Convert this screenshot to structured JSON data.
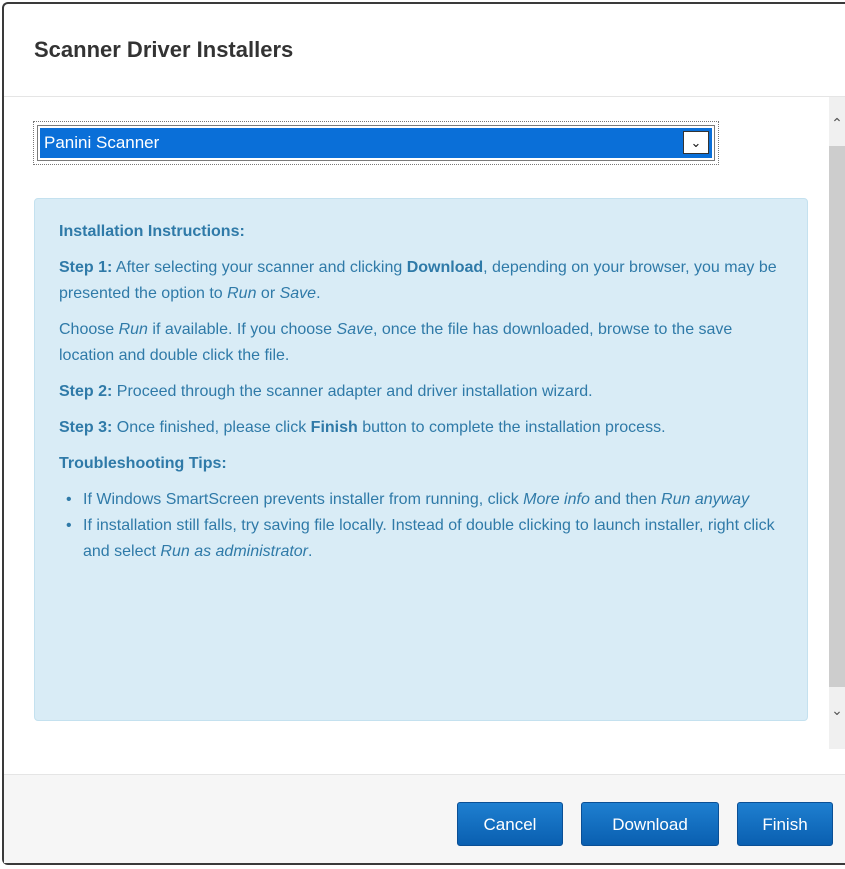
{
  "dialog": {
    "title": "Scanner Driver Installers"
  },
  "scanner_select": {
    "selected": "Panini Scanner",
    "arrow_icon": "chevron-down-icon"
  },
  "instructions": {
    "heading": "Installation Instructions:",
    "step1": {
      "label": "Step 1:",
      "text_a": " After selecting your scanner and clicking ",
      "bold": "Download",
      "text_b": ", depending on your browser, you may be presented the option to ",
      "run": "Run",
      "or": " or ",
      "save": "Save",
      "end": "."
    },
    "choose": {
      "a": "Choose ",
      "run": "Run",
      "b": " if available. If you choose ",
      "save": "Save",
      "c": ", once the file has downloaded, browse to the save location and double click the file."
    },
    "step2": {
      "label": "Step 2:",
      "text": " Proceed through the scanner adapter and driver installation wizard."
    },
    "step3": {
      "label": "Step 3:",
      "text_a": " Once finished, please click ",
      "bold": "Finish",
      "text_b": " button to complete the installation process."
    },
    "troubleshooting_heading": "Troubleshooting Tips:",
    "tips": [
      {
        "a": "If Windows SmartScreen prevents installer from running, click ",
        "em1": "More info",
        "b": " and then ",
        "em2": "Run anyway",
        "c": ""
      },
      {
        "a": "If installation still falls, try saving file locally. Instead of double clicking to launch installer, right click and select ",
        "em1": "Run as administrator",
        "b": ".",
        "em2": "",
        "c": ""
      }
    ]
  },
  "footer": {
    "cancel_label": "Cancel",
    "download_label": "Download",
    "finish_label": "Finish"
  },
  "colors": {
    "primary_button": "#0a6fd8",
    "info_panel_bg": "#d9ecf6",
    "info_text": "#2f7aa8",
    "selected_option_bg": "#0a6fd8"
  }
}
